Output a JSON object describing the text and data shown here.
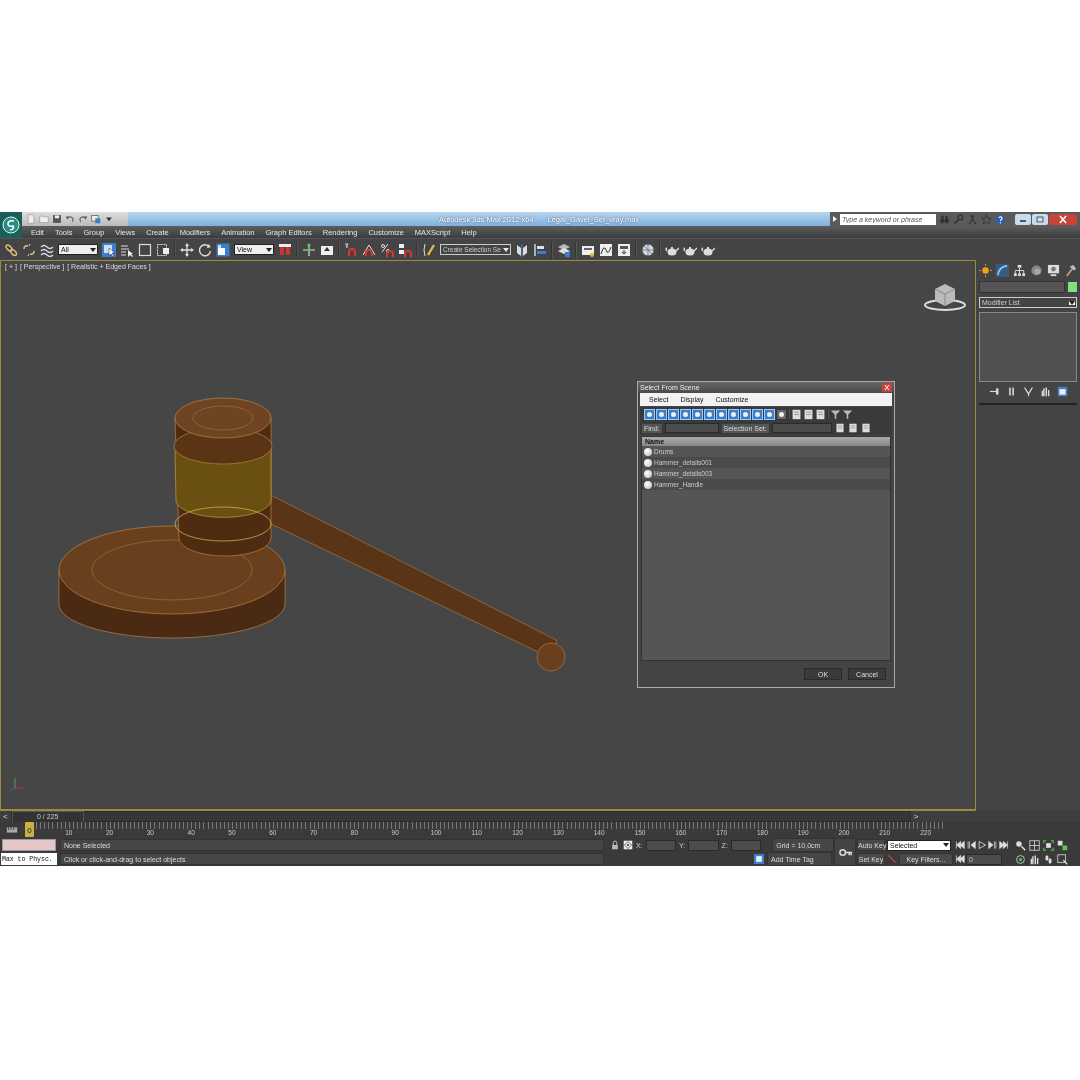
{
  "title_bar": {
    "app_name": "Autodesk 3ds Max  2012 x64",
    "file_name": "Legal_Gavel_Set_vray.max",
    "search": {
      "placeholder": "Type a keyword or phrase"
    }
  },
  "menu": [
    "Edit",
    "Tools",
    "Group",
    "Views",
    "Create",
    "Modifiers",
    "Animation",
    "Graph Editors",
    "Rendering",
    "Customize",
    "MAXScript",
    "Help"
  ],
  "toolbar": {
    "selection_filter": "All",
    "reference_coordinate": "View",
    "named_selection_set": "Create Selection Se"
  },
  "viewport": {
    "labels": [
      "[ + ]",
      "[ Perspective ]",
      "[ Realistic + Edged Faces ]"
    ]
  },
  "command_panel": {
    "modifier_list": "Modifier List"
  },
  "dialog": {
    "title": "Select From Scene",
    "menu": [
      "Select",
      "Display",
      "Customize"
    ],
    "filters": [
      {
        "on": true
      },
      {
        "on": true
      },
      {
        "on": true
      },
      {
        "on": true
      },
      {
        "on": true
      },
      {
        "on": true
      },
      {
        "on": true
      },
      {
        "on": true
      },
      {
        "on": true
      },
      {
        "on": true
      },
      {
        "on": true
      },
      {
        "on": false
      }
    ],
    "find_label": "Find:",
    "selection_set_label": "Selection Set:",
    "column": "Name",
    "rows": [
      "Drums",
      "Hammer_details001",
      "Hammer_details003",
      "Hammer_Handle"
    ],
    "buttons": [
      "OK",
      "Cancel"
    ]
  },
  "time_slider": {
    "prev": "<",
    "position": "0 / 225",
    "next": ">",
    "level": 0
  },
  "track_bar": {
    "start": "0",
    "ticks": [
      "10",
      "20",
      "30",
      "40",
      "50",
      "60",
      "70",
      "80",
      "90",
      "100",
      "110",
      "120",
      "130",
      "140",
      "150",
      "160",
      "170",
      "180",
      "190",
      "200",
      "210",
      "220"
    ]
  },
  "status": {
    "mini_listener": "Max to Physc.",
    "selection": "None Selected",
    "prompt": "Click or click-and-drag to select objects",
    "x_label": "X:",
    "y_label": "Y:",
    "z_label": "Z:",
    "grid": "Grid = 10,0cm",
    "time_tag": "Add Time Tag",
    "auto_key": "Auto Key",
    "set_key": "Set Key",
    "key_mode": "Selected",
    "key_filters": "Key Filters...",
    "current_frame": "0"
  }
}
